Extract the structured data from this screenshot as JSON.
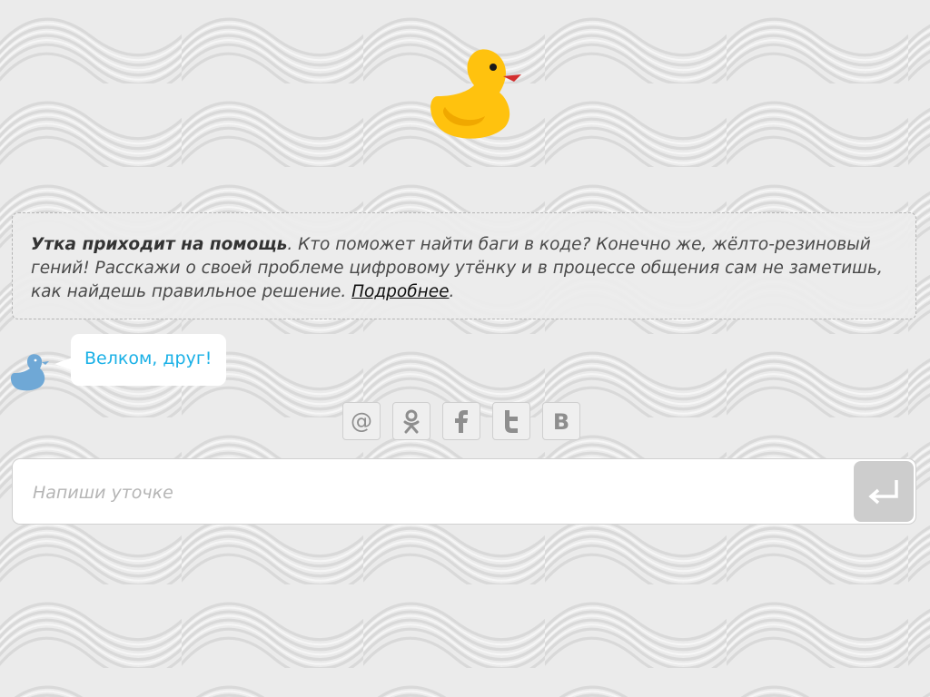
{
  "intro": {
    "title": "Утка приходит на помощь",
    "body": ". Кто поможет найти баги в коде? Конечно же, жёлто-резиновый гений! Расскажи о своей проблеме цифровому утёнку и в процессе общения сам не заметишь, как найдешь правильное решение. ",
    "more_link": "Подробнее",
    "end": "."
  },
  "chat": {
    "greeting": "Велком, друг!"
  },
  "share": {
    "buttons": [
      {
        "icon": "email-at-icon"
      },
      {
        "icon": "odnoklassniki-icon"
      },
      {
        "icon": "facebook-icon"
      },
      {
        "icon": "twitter-icon"
      },
      {
        "icon": "vkontakte-icon"
      }
    ]
  },
  "composer": {
    "placeholder": "Напиши уточке",
    "send_icon": "enter-return-icon"
  },
  "colors": {
    "background": "#ebebeb",
    "duck_body": "#ffc20e",
    "duck_beak": "#d32f2f",
    "greeting_text": "#19b0e6",
    "avatar": "#6fa8d6",
    "send_button": "#cdcdcd"
  }
}
